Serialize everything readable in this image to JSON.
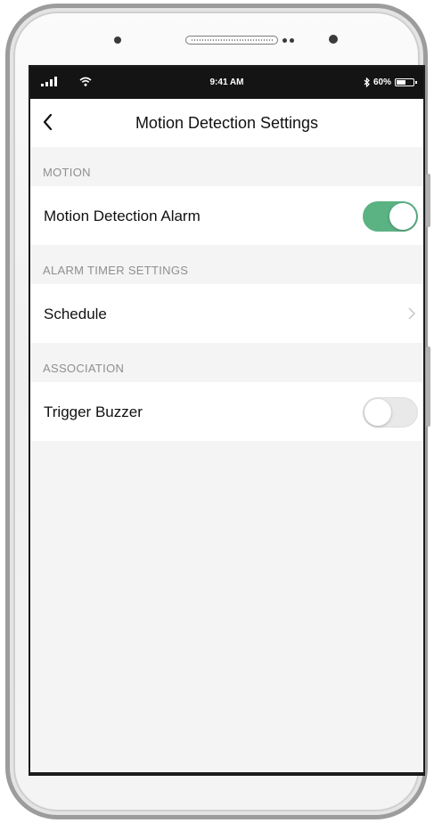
{
  "status_bar": {
    "time": "9:41 AM",
    "battery_percent_text": "60%",
    "battery_level": 0.6,
    "icons": [
      "signal-icon",
      "wifi-icon",
      "bluetooth-icon",
      "battery-icon"
    ]
  },
  "nav": {
    "back_icon": "chevron-left-icon",
    "title": "Motion Detection Settings"
  },
  "sections": [
    {
      "header": "MOTION",
      "row": {
        "label": "Motion Detection Alarm",
        "control": "toggle",
        "value": true
      }
    },
    {
      "header": "ALARM TIMER SETTINGS",
      "row": {
        "label": "Schedule",
        "control": "chevron-right-icon"
      }
    },
    {
      "header": "ASSOCIATION",
      "row": {
        "label": "Trigger Buzzer",
        "control": "toggle",
        "value": false
      }
    }
  ],
  "colors": {
    "toggle_on": "#5bb283",
    "toggle_off": "#e9e9e9",
    "background": "#f4f4f4",
    "section_header_text": "#8f8f8f",
    "status_bar": "#141414"
  }
}
